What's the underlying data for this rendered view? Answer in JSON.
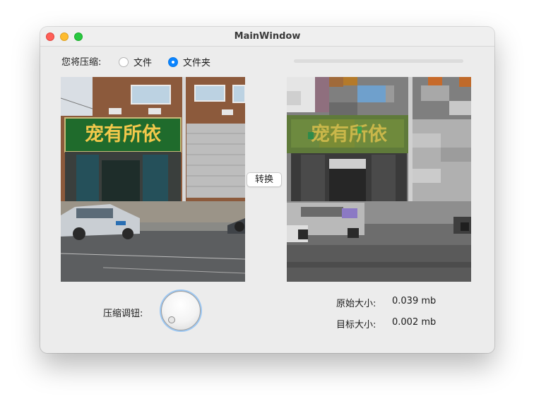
{
  "window": {
    "title": "MainWindow"
  },
  "controls": {
    "compress_label": "您将压缩:",
    "options": [
      {
        "label": "文件",
        "checked": false
      },
      {
        "label": "文件夹",
        "checked": true
      }
    ],
    "progress": 0
  },
  "convert_button": "转换",
  "dial": {
    "label": "压缩调钮:"
  },
  "info": {
    "original_size_label": "原始大小:",
    "original_size_value": "0.039 mb",
    "target_size_label": "目标大小:",
    "target_size_value": "0.002 mb"
  },
  "images": {
    "original_sign_text": "宠有所依",
    "compressed_sign_text": "宠有所依"
  },
  "colors": {
    "radio_selected": "#0a84ff",
    "sign_green": "#1f6b2c",
    "sign_text": "#f2c84b"
  }
}
